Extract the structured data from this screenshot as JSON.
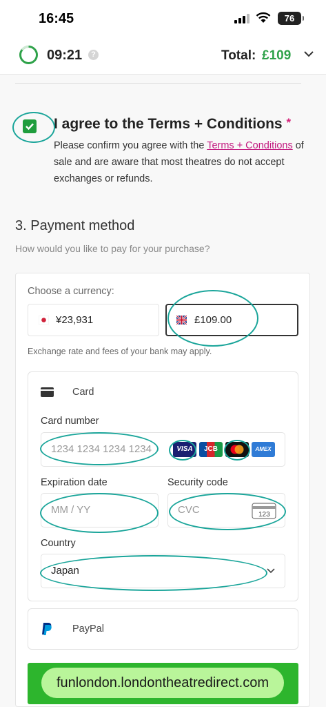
{
  "status_bar": {
    "time": "16:45",
    "battery": "76"
  },
  "header": {
    "timer": "09:21",
    "help_icon_glyph": "?",
    "total_label": "Total:",
    "total_value": "£109",
    "total_color": "#2fa24a"
  },
  "terms": {
    "title": "I agree to the Terms + Conditions",
    "required_marker": "*",
    "body_before_link": "Please confirm you agree with the ",
    "link_text": "Terms + Conditions",
    "body_after_link": " of sale and are aware that most theatres do not accept exchanges or refunds.",
    "checked": true
  },
  "payment": {
    "title": "3. Payment method",
    "subtitle": "How would you like to pay for your purchase?",
    "currency_label": "Choose a currency:",
    "currency_options": [
      {
        "flag": "japan-flag-icon",
        "amount": "¥23,931",
        "selected": false
      },
      {
        "flag": "uk-flag-icon",
        "amount": "£109.00",
        "selected": true
      }
    ],
    "exchange_note": "Exchange rate and fees of your bank may apply.",
    "card": {
      "title": "Card",
      "card_number_label": "Card number",
      "card_number_placeholder": "1234 1234 1234 1234",
      "brands": [
        "VISA",
        "JCB",
        "Mastercard",
        "AMEX"
      ],
      "expiration_label": "Expiration date",
      "expiration_placeholder": "MM / YY",
      "security_label": "Security code",
      "security_placeholder": "CVC",
      "cvc_icon_text": "123",
      "country_label": "Country",
      "country_value": "Japan"
    },
    "paypal_label": "PayPal"
  },
  "overlay_url": "funlondon.londontheatredirect.com",
  "annotation_color": "#1aa59a"
}
